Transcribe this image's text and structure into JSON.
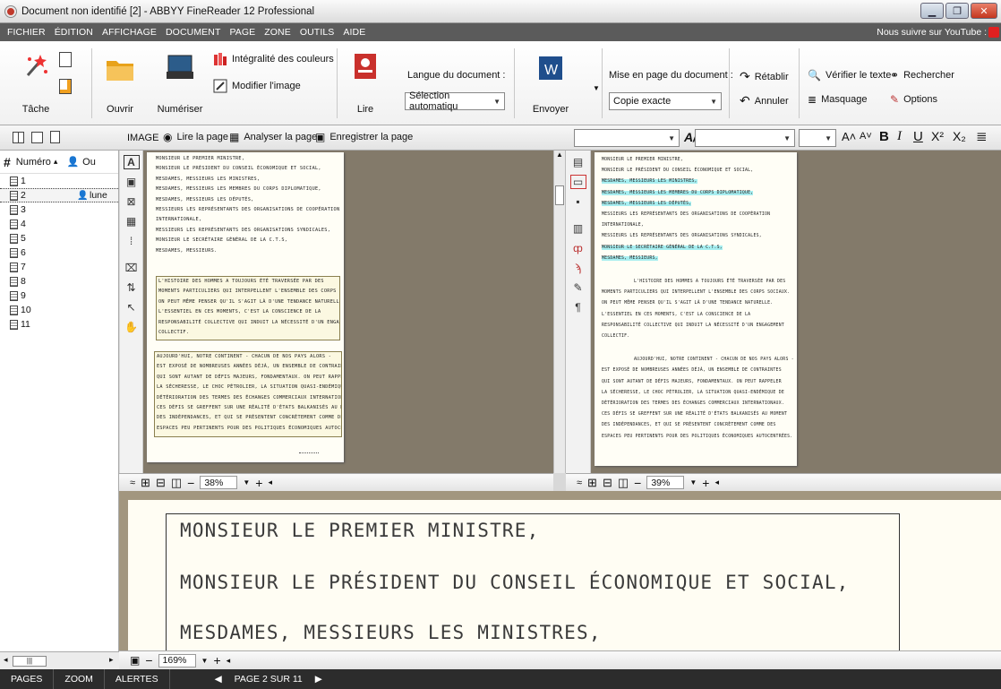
{
  "window": {
    "title": "Document non identifié [2] - ABBYY FineReader 12 Professional"
  },
  "menu": {
    "items": [
      "FICHIER",
      "ÉDITION",
      "AFFICHAGE",
      "DOCUMENT",
      "PAGE",
      "ZONE",
      "OUTILS",
      "AIDE"
    ],
    "youtube": "Nous suivre sur YouTube :"
  },
  "ribbon": {
    "tache": "Tâche",
    "ouvrir": "Ouvrir",
    "numeriser": "Numériser",
    "integralite": "Intégralité des couleurs",
    "modifier": "Modifier l'image",
    "lire": "Lire",
    "langue_label": "Langue du document :",
    "langue_value": "Sélection automatiqu",
    "envoyer": "Envoyer",
    "mise_label": "Mise en page du document :",
    "mise_value": "Copie exacte",
    "retablir": "Rétablir",
    "annuler": "Annuler",
    "verifier": "Vérifier le texte",
    "masquage": "Masquage",
    "rechercher": "Rechercher",
    "options": "Options"
  },
  "toolbar2": {
    "image": "IMAGE",
    "lire_page": "Lire la page",
    "analyser": "Analyser la page",
    "enregistrer": "Enregistrer la page"
  },
  "pages_panel": {
    "col_num": "Numéro",
    "col_other": "Ou",
    "lune": "lune",
    "pages": [
      "1",
      "2",
      "3",
      "4",
      "5",
      "6",
      "7",
      "8",
      "9",
      "10",
      "11"
    ]
  },
  "image_page": {
    "lines1": [
      "MONSIEUR LE PREMIER MINISTRE,",
      "MONSIEUR LE PRÉSIDENT DU CONSEIL ÉCONOMIQUE ET SOCIAL,",
      "MESDAMES, MESSIEURS LES MINISTRES,",
      "MESDAMES, MESSIEURS LES MEMBRES DU CORPS DIPLOMATIQUE,",
      "MESDAMES, MESSIEURS LES DÉPUTÉS,",
      "MESSIEURS LES REPRÉSENTANTS DES ORGANISATIONS DE COOPÉRATION",
      "INTERNATIONALE,",
      "MESSIEURS LES REPRÉSENTANTS DES ORGANISATIONS SYNDICALES,",
      "MONSIEUR LE SECRÉTAIRE GÉNÉRAL DE LA C.T.S,",
      "MESDAMES, MESSIEURS."
    ],
    "lines2": [
      "L'HISTOIRE DES HOMMES A TOUJOURS ÉTÉ TRAVERSÉE PAR DES",
      "MOMENTS PARTICULIERS QUI INTERPELLENT L'ENSEMBLE DES CORPS SOCIAUX.",
      "ON PEUT MÊME PENSER QU'IL S'AGIT LÀ D'UNE TENDANCE NATURELLE.",
      "L'ESSENTIEL EN CES MOMENTS, C'EST LA CONSCIENCE DE LA",
      "RESPONSABILITÉ COLLECTIVE QUI INDUIT LA NÉCESSITÉ D'UN ENGAGEMENT",
      "COLLECTIF."
    ],
    "lines3": [
      "AUJOURD'HUI, NOTRE CONTINENT - CHACUN DE NOS PAYS ALORS -",
      "EST EXPOSÉ DE NOMBREUSES ANNÉES DÉJÀ, UN ENSEMBLE DE CONTRAINTES",
      "QUI SONT AUTANT DE DÉFIS MAJEURS, FONDAMENTAUX. ON PEUT RAPPELER",
      "LA SÉCHERESSE, LE CHOC PÉTROLIER, LA SITUATION QUASI-ENDÉMIQUE DE",
      "DÉTÉRIORATION DES TERMES DES ÉCHANGES COMMERCIAUX INTERNATIONAUX.",
      "CES DÉFIS SE GREFFENT SUR UNE RÉALITÉ D'ÉTATS BALKANISÉS AU MOMENT",
      "DES INDÉPENDANCES, ET QUI SE PRÉSENTENT CONCRÈTEMENT COMME DES",
      "ESPACES PEU PERTINENTS POUR DES POLITIQUES ÉCONOMIQUES AUTOCENTRÉES."
    ]
  },
  "text_page": {
    "lines": [
      "MONSIEUR LE PREMIER MINISTRE,",
      "MONSIEUR LE PRÉSIDENT DU CONSEIL ÉCONOMIQUE ET SOCIAL,",
      "MESDAMES, MESSIEURS LES MINISTRES,",
      "MESDAMES, MESSIEURS LES MEMBRES DU CORPS DIPLOMATIQUE,",
      "MESDAMES, MESSIEURS LES DÉPUTÉS,",
      "MESSIEURS LES REPRÉSENTANTS DES ORGANISATIONS DE COOPÉRATION",
      "INTERNATIONALE,",
      "MESSIEURS LES REPRÉSENTANTS DES ORGANISATIONS SYNDICALES,",
      "MONSIEUR LE SECRÉTAIRE GÉNÉRAL DE LA C.T.S,",
      "MESDAMES, MESSIEURS,",
      "L'HISTOIRE DES HOMMES A TOUJOURS ÉTÉ TRAVERSÉE PAR DES",
      "MOMENTS PARTICULIERS QUI INTERPELLENT L'ENSEMBLE DES CORPS SOCIAUX.",
      "ON PEUT MÊME PENSER QU'IL S'AGIT LÀ D'UNE TENDANCE NATURELLE.",
      "L'ESSENTIEL EN CES MOMENTS, C'EST LA CONSCIENCE DE LA",
      "RESPONSABILITÉ COLLECTIVE QUI INDUIT LA NÉCESSITÉ D'UN ENGAGEMENT",
      "COLLECTIF.",
      "AUJOURD'HUI, NOTRE CONTINENT - CHACUN DE NOS PAYS ALORS -",
      "EST EXPOSÉ DE NOMBREUSES ANNÉES DÉJÀ, UN ENSEMBLE DE CONTRAINTES",
      "QUI SONT AUTANT DE DÉFIS MAJEURS, FONDAMENTAUX. ON PEUT RAPPELER",
      "LA SÉCHERESSE, LE CHOC PÉTROLIER, LA SITUATION QUASI-ENDÉMIQUE DE",
      "DÉTÉRIORATION DES TERMES DES ÉCHANGES COMMERCIAUX INTERNATIONAUX.",
      "CES DÉFIS SE GREFFENT SUR UNE RÉALITÉ D'ÉTATS BALKANISÉS AU MOMENT",
      "DES INDÉPENDANCES, ET QUI SE PRÉSENTENT CONCRÈTEMENT COMME DES",
      "ESPACES PEU PERTINENTS POUR DES POLITIQUES ÉCONOMIQUES AUTOCENTRÉES."
    ]
  },
  "zoom": {
    "image": "38%",
    "text": "39%",
    "zoom_pane": "169%"
  },
  "zoom_lines": [
    "MONSIEUR LE PREMIER MINISTRE,",
    "MONSIEUR LE PRÉSIDENT DU CONSEIL ÉCONOMIQUE ET SOCIAL,",
    "MESDAMES, MESSIEURS LES MINISTRES,"
  ],
  "status": {
    "pages": "PAGES",
    "zoom": "ZOOM",
    "alertes": "ALERTES",
    "page": "PAGE 2 SUR 11"
  },
  "colors": {
    "menubar": "#5b5b5b",
    "statusbar": "#2c2c2c",
    "highlight": "#a7eef0",
    "pane_bg": "#837a6a"
  }
}
